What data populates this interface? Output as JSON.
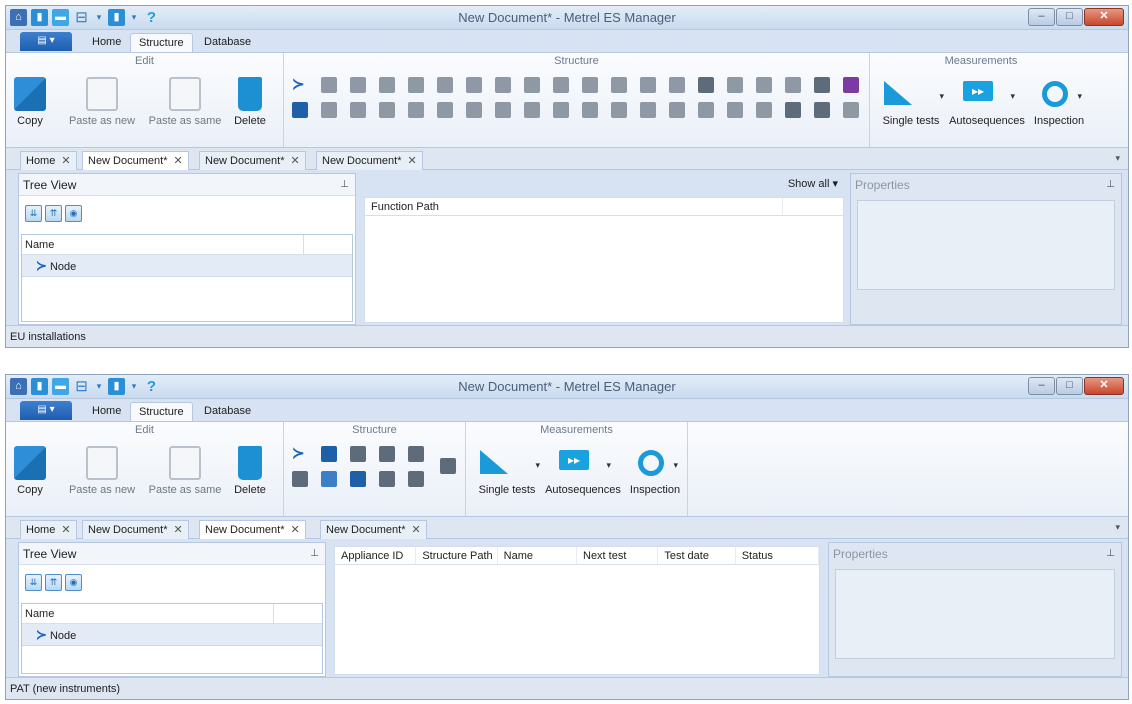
{
  "windows": [
    {
      "title": "New Document* - Metrel ES Manager",
      "ribbon_tabs": [
        "Home",
        "Structure",
        "Database"
      ],
      "active_ribbon_tab": "Structure",
      "groups": {
        "edit": "Edit",
        "structure": "Structure",
        "measurements": "Measurements"
      },
      "edit_buttons": {
        "copy": "Copy",
        "paste_new": "Paste as new",
        "paste_same": "Paste as same",
        "delete": "Delete"
      },
      "measure_buttons": {
        "single": "Single tests",
        "auto": "Autosequences",
        "inspection": "Inspection"
      },
      "doc_tabs": [
        "Home",
        "New Document*",
        "New Document*",
        "New Document*"
      ],
      "active_doc_tab": 1,
      "tree": {
        "title": "Tree View",
        "header": "Name",
        "node": "Node"
      },
      "show_all": "Show all",
      "columns": [
        "Function Path"
      ],
      "properties_title": "Properties",
      "status": "EU installations"
    },
    {
      "title": "New Document* - Metrel ES Manager",
      "ribbon_tabs": [
        "Home",
        "Structure",
        "Database"
      ],
      "active_ribbon_tab": "Structure",
      "groups": {
        "edit": "Edit",
        "structure": "Structure",
        "measurements": "Measurements"
      },
      "edit_buttons": {
        "copy": "Copy",
        "paste_new": "Paste as new",
        "paste_same": "Paste as same",
        "delete": "Delete"
      },
      "measure_buttons": {
        "single": "Single tests",
        "auto": "Autosequences",
        "inspection": "Inspection"
      },
      "doc_tabs": [
        "Home",
        "New Document*",
        "New Document*",
        "New Document*"
      ],
      "active_doc_tab": 2,
      "tree": {
        "title": "Tree View",
        "header": "Name",
        "node": "Node"
      },
      "columns": [
        "Appliance ID",
        "Structure Path",
        "Name",
        "Next test",
        "Test date",
        "Status"
      ],
      "properties_title": "Properties",
      "status": "PAT (new instruments)"
    }
  ]
}
